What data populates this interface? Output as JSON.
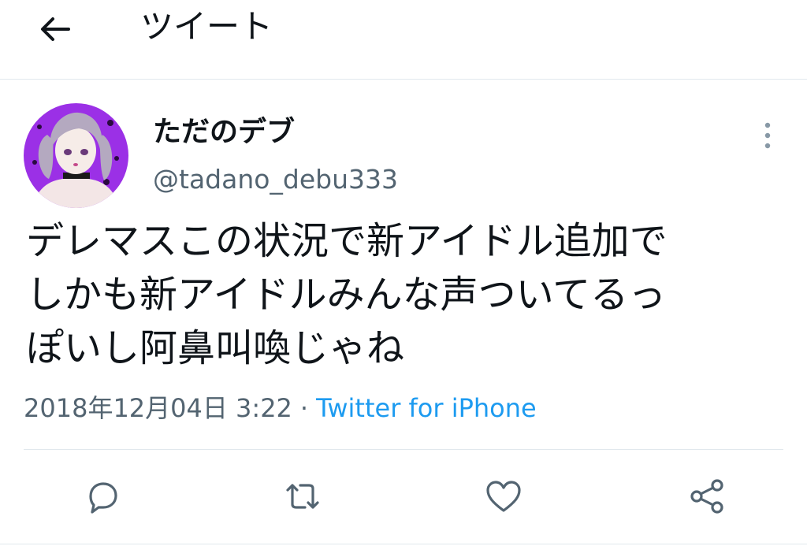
{
  "header": {
    "title": "ツイート",
    "back_icon": "arrow-left-icon"
  },
  "tweet": {
    "display_name": "ただのデブ",
    "handle": "@tadano_debu333",
    "text_lines": [
      "デレマスこの状況で新アイドル追加で",
      "しかも新アイドルみんな声ついてるっ",
      "ぽいし阿鼻叫喚じゃね"
    ],
    "timestamp": "2018年12月04日 3:22",
    "separator": "·",
    "source": "Twitter for iPhone"
  },
  "actions": [
    {
      "name": "reply",
      "icon": "reply-icon"
    },
    {
      "name": "retweet",
      "icon": "retweet-icon"
    },
    {
      "name": "like",
      "icon": "heart-icon"
    },
    {
      "name": "share",
      "icon": "share-icon"
    }
  ],
  "colors": {
    "accent": "#1d9bf0",
    "secondary_text": "#536471",
    "icon": "#536471",
    "avatar_bg": "#9b30e6"
  }
}
